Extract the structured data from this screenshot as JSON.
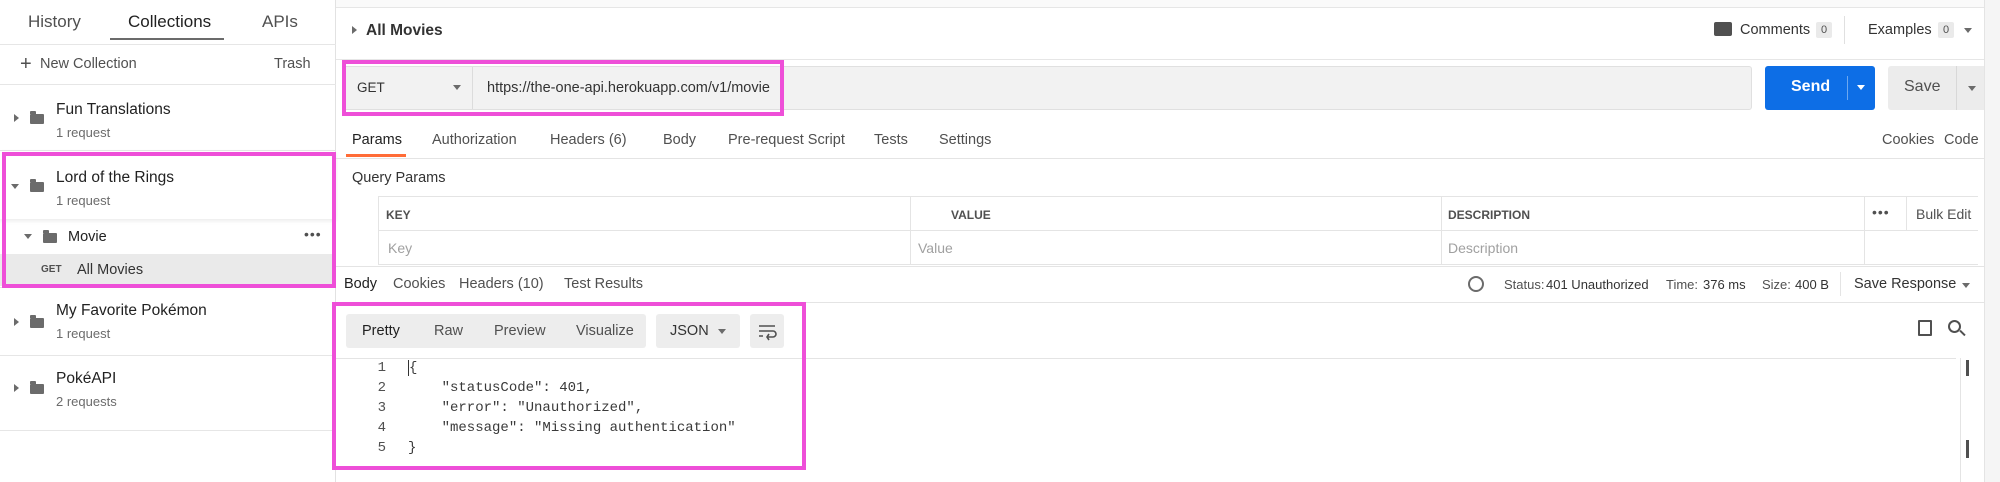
{
  "sidebar": {
    "tabs": [
      "History",
      "Collections",
      "APIs"
    ],
    "new_collection": "New Collection",
    "trash": "Trash",
    "collections": [
      {
        "name": "Fun Translations",
        "count": "1 request"
      },
      {
        "name": "Lord of the Rings",
        "count": "1 request"
      },
      {
        "name": "My Favorite Pokémon",
        "count": "1 request"
      },
      {
        "name": "PokéAPI",
        "count": "2 requests"
      }
    ],
    "folder": {
      "name": "Movie",
      "more": "•••"
    },
    "request": {
      "method": "GET",
      "name": "All Movies"
    }
  },
  "header": {
    "title": "All Movies",
    "comments_label": "Comments",
    "comments_count": "0",
    "examples_label": "Examples",
    "examples_count": "0"
  },
  "request": {
    "method": "GET",
    "url": "https://the-one-api.herokuapp.com/v1/movie",
    "send": "Send",
    "save": "Save",
    "tabs": [
      "Params",
      "Authorization",
      "Headers (6)",
      "Body",
      "Pre-request Script",
      "Tests",
      "Settings"
    ],
    "cookies": "Cookies",
    "code": "Code"
  },
  "params": {
    "title": "Query Params",
    "columns": [
      "KEY",
      "VALUE",
      "DESCRIPTION"
    ],
    "placeholders": [
      "Key",
      "Value",
      "Description"
    ],
    "more": "•••",
    "bulk_edit": "Bulk Edit"
  },
  "response": {
    "tabs": [
      "Body",
      "Cookies",
      "Headers (10)",
      "Test Results"
    ],
    "status_label": "Status:",
    "status": "401 Unauthorized",
    "time_label": "Time:",
    "time": "376 ms",
    "size_label": "Size:",
    "size": "400 B",
    "save_response": "Save Response",
    "views": [
      "Pretty",
      "Raw",
      "Preview",
      "Visualize"
    ],
    "format": "JSON",
    "lines": [
      {
        "n": "1",
        "text": "{"
      },
      {
        "n": "2",
        "text": "    \"statusCode\": 401,"
      },
      {
        "n": "3",
        "text": "    \"error\": \"Unauthorized\","
      },
      {
        "n": "4",
        "text": "    \"message\": \"Missing authentication\""
      },
      {
        "n": "5",
        "text": "}"
      }
    ]
  },
  "colors": {
    "highlight": "#ee4fd8",
    "send_button": "#0d6ee6"
  },
  "icons": [
    "plus-icon",
    "folder-icon",
    "caret-right-icon",
    "caret-down-icon",
    "comment-icon",
    "globe-icon",
    "wrap-icon",
    "copy-icon",
    "search-icon"
  ]
}
